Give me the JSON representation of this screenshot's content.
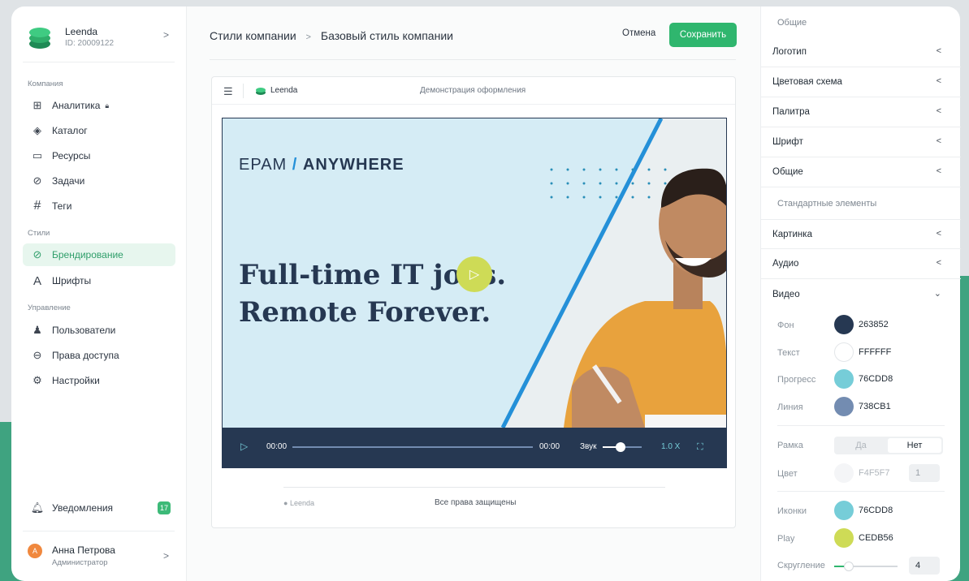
{
  "sidebar": {
    "brand_name": "Leenda",
    "brand_id": "ID: 20009122",
    "section_company": "Компания",
    "section_styles": "Стили",
    "section_manage": "Управление",
    "items": [
      {
        "label": "Аналитика",
        "icon": "analytics-icon"
      },
      {
        "label": "Каталог",
        "icon": "catalog-icon"
      },
      {
        "label": "Ресурсы",
        "icon": "folder-icon"
      },
      {
        "label": "Задачи",
        "icon": "tasks-icon"
      },
      {
        "label": "Теги",
        "icon": "hash-icon"
      },
      {
        "label": "Брендирование",
        "icon": "brush-icon"
      },
      {
        "label": "Шрифты",
        "icon": "font-icon"
      },
      {
        "label": "Пользователи",
        "icon": "users-icon"
      },
      {
        "label": "Права доступа",
        "icon": "access-icon"
      },
      {
        "label": "Настройки",
        "icon": "gear-icon"
      }
    ],
    "notifications_label": "Уведомления",
    "notifications_count": "17",
    "user_initial": "А",
    "user_name": "Анна Петрова",
    "user_role": "Администратор"
  },
  "header": {
    "crumb_1": "Стили компании",
    "crumb_sep": ">",
    "crumb_2": "Базовый стиль компании",
    "cancel_label": "Отмена",
    "save_label": "Сохранить"
  },
  "preview": {
    "brand": "Leenda",
    "demo_label": "Демонстрация оформления",
    "epam_prefix": "EPAM",
    "epam_slash": "/",
    "epam_suffix": "ANYWHERE",
    "headline": "Full-time IT jobs.\nRemote Forever.",
    "time_start": "00:00",
    "time_end": "00:00",
    "sound_label": "Звук",
    "speed": "1.0 X",
    "footer_brand": "Leenda",
    "footer_rights": "Все права защищены"
  },
  "settings": {
    "group_general": "Общие",
    "group_standard": "Стандартные элементы",
    "sections": [
      "Логотип",
      "Цветовая схема",
      "Палитра",
      "Шрифт",
      "Общие"
    ],
    "sections2": [
      "Картинка",
      "Аудио",
      "Видео"
    ],
    "video": {
      "bg_label": "Фон",
      "bg_hex": "263852",
      "bg_color": "#263852",
      "text_label": "Текст",
      "text_hex": "FFFFFF",
      "text_color": "#FFFFFF",
      "progress_label": "Прогресс",
      "progress_hex": "76CDD8",
      "progress_color": "#76CDD8",
      "line_label": "Линия",
      "line_hex": "738CB1",
      "line_color": "#738CB1",
      "frame_label": "Рамка",
      "frame_yes": "Да",
      "frame_no": "Нет",
      "color_label": "Цвет",
      "color_hex": "F4F5F7",
      "color_num": "1",
      "icons_label": "Иконки",
      "icons_hex": "76CDD8",
      "icons_color": "#76CDD8",
      "play_label": "Play",
      "play_hex": "CEDB56",
      "play_color": "#CEDB56",
      "radius_label": "Скругление",
      "radius_value": "4"
    }
  }
}
